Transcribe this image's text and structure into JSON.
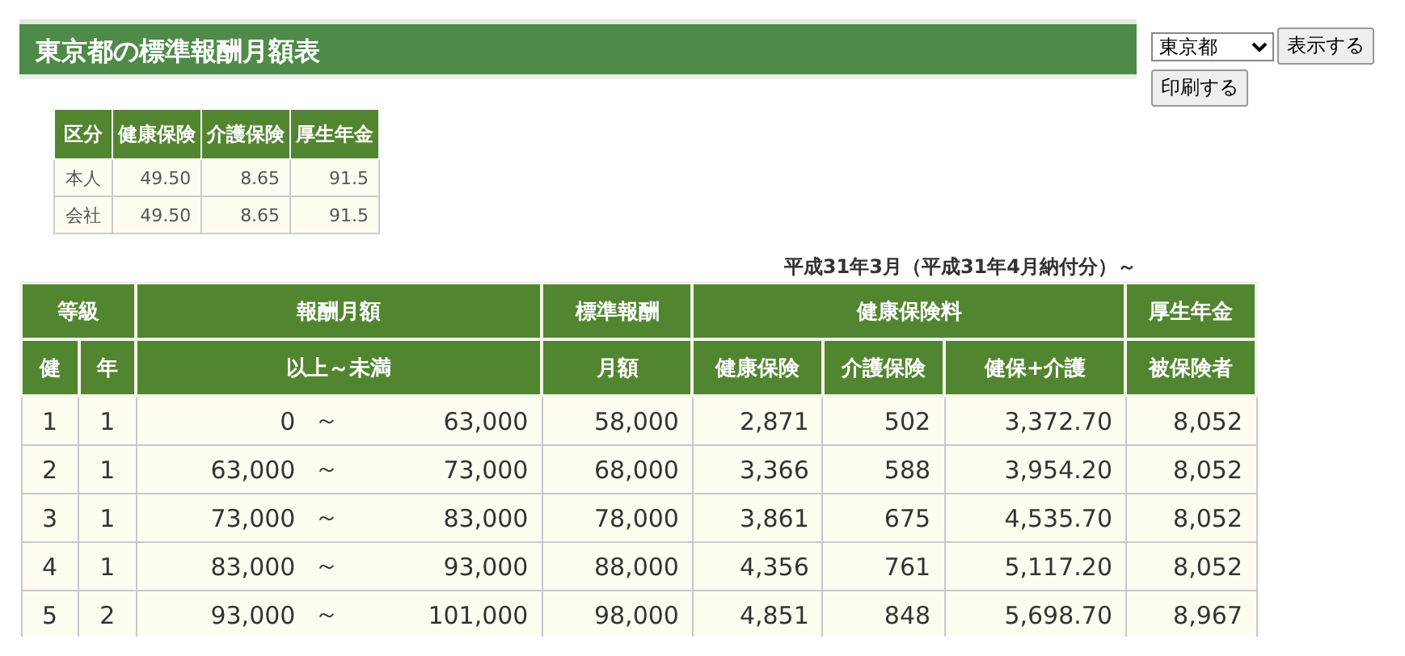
{
  "title": "東京都の標準報酬月額表",
  "controls": {
    "prefecture": "東京都",
    "show_button": "表示する",
    "print_button": "印刷する"
  },
  "rates": {
    "columns": [
      "区分",
      "健康保険",
      "介護保険",
      "厚生年金"
    ],
    "rows": [
      [
        "本人",
        "49.50",
        "8.65",
        "91.5"
      ],
      [
        "会社",
        "49.50",
        "8.65",
        "91.5"
      ]
    ]
  },
  "period": "平成31年3月（平成31年4月納付分）～",
  "table": {
    "group_headers": [
      "等級",
      "報酬月額",
      "標準報酬",
      "健康保険料",
      "厚生年金"
    ],
    "sub_headers": [
      "健",
      "年",
      "以上～未満",
      "月額",
      "健康保険",
      "介護保険",
      "健保+介護",
      "被保険者"
    ],
    "rows": [
      {
        "health_grade": "1",
        "pension_grade": "1",
        "from": "0",
        "sep": "～",
        "to": "63,000",
        "standard": "58,000",
        "health": "2,871",
        "care": "502",
        "health_care": "3,372.70",
        "pension": "8,052"
      },
      {
        "health_grade": "2",
        "pension_grade": "1",
        "from": "63,000",
        "sep": "～",
        "to": "73,000",
        "standard": "68,000",
        "health": "3,366",
        "care": "588",
        "health_care": "3,954.20",
        "pension": "8,052"
      },
      {
        "health_grade": "3",
        "pension_grade": "1",
        "from": "73,000",
        "sep": "～",
        "to": "83,000",
        "standard": "78,000",
        "health": "3,861",
        "care": "675",
        "health_care": "4,535.70",
        "pension": "8,052"
      },
      {
        "health_grade": "4",
        "pension_grade": "1",
        "from": "83,000",
        "sep": "～",
        "to": "93,000",
        "standard": "88,000",
        "health": "4,356",
        "care": "761",
        "health_care": "5,117.20",
        "pension": "8,052"
      },
      {
        "health_grade": "5",
        "pension_grade": "2",
        "from": "93,000",
        "sep": "～",
        "to": "101,000",
        "standard": "98,000",
        "health": "4,851",
        "care": "848",
        "health_care": "5,698.70",
        "pension": "8,967"
      }
    ]
  }
}
